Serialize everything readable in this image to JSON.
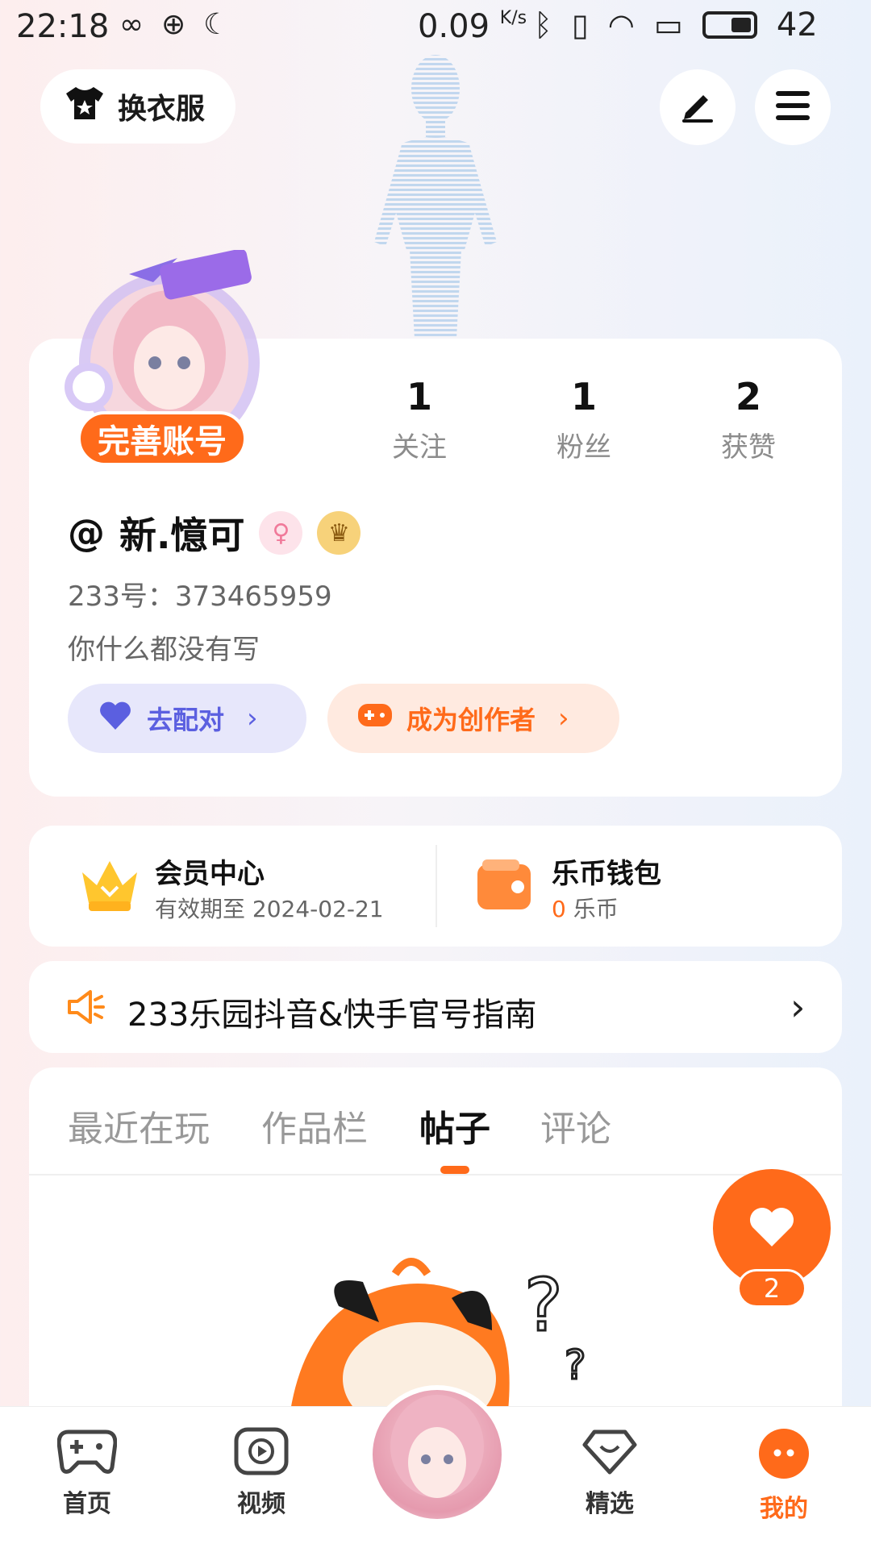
{
  "status_bar": {
    "time": "22:18",
    "speed": "0.09",
    "speed_unit": "K/s",
    "battery": "42"
  },
  "top": {
    "outfit_label": "换衣服",
    "edit_icon": "pencil-icon",
    "menu_icon": "hamburger-menu-icon"
  },
  "profile": {
    "complete_account": "完善账号",
    "stats": [
      {
        "num": "1",
        "label": "关注"
      },
      {
        "num": "1",
        "label": "粉丝"
      },
      {
        "num": "2",
        "label": "获赞"
      }
    ],
    "at": "@",
    "name": "新.憶可",
    "uid": "233号：373465959",
    "bio": "你什么都没有写",
    "pair_label": "去配对",
    "creator_label": "成为创作者"
  },
  "member": {
    "title": "会员中心",
    "sub": "有效期至 2024-02-21"
  },
  "wallet": {
    "title": "乐币钱包",
    "amount": "0",
    "unit": "乐币"
  },
  "notice": {
    "text": "233乐园抖音&快手官号指南"
  },
  "tabs": [
    {
      "label": "最近在玩",
      "active": false
    },
    {
      "label": "作品栏",
      "active": false
    },
    {
      "label": "帖子",
      "active": true
    },
    {
      "label": "评论",
      "active": false
    }
  ],
  "float_like": {
    "count": "2"
  },
  "bottom_nav": [
    {
      "label": "首页",
      "icon": "gamepad-icon",
      "active": false
    },
    {
      "label": "视频",
      "icon": "video-play-icon",
      "active": false
    },
    {
      "label": "精选",
      "icon": "heart-gem-icon",
      "active": false
    },
    {
      "label": "我的",
      "icon": "profile-face-icon",
      "active": true
    }
  ],
  "colors": {
    "accent": "#ff6a1a",
    "pair_bg": "#e7e7fb",
    "pair_fg": "#5b5fe0",
    "creator_bg": "#ffeae0",
    "creator_fg": "#ff6a1a"
  }
}
